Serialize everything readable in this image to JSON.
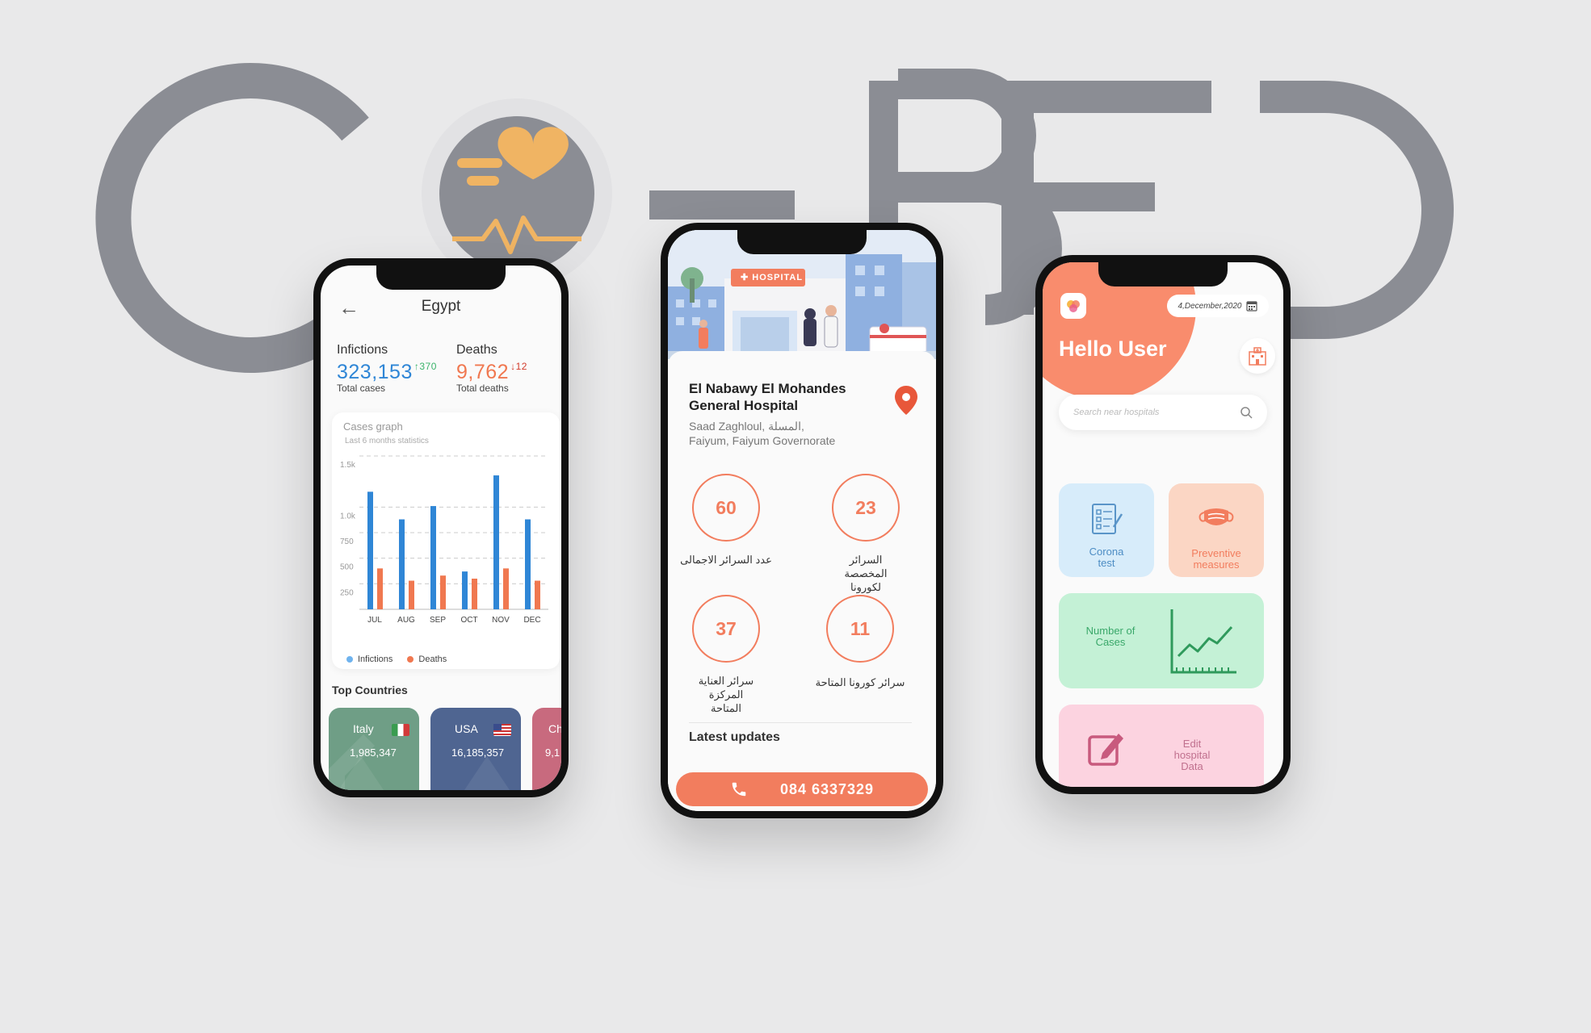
{
  "colors": {
    "accent": "#f27d5e",
    "infections": "#2f86d6",
    "deaths": "#f07850",
    "logo": "#8b8d94"
  },
  "stats_screen": {
    "title": "Egypt",
    "infections": {
      "label": "Infictions",
      "value": "323,153",
      "delta": "370",
      "sub": "Total cases"
    },
    "deaths": {
      "label": "Deaths",
      "value": "9,762",
      "delta": "12",
      "sub": "Total deaths"
    },
    "graph": {
      "title": "Cases graph",
      "subtitle": "Last 6 months statistics",
      "legend_infections": "Infictions",
      "legend_deaths": "Deaths"
    },
    "top_countries_label": "Top Countries",
    "countries": [
      {
        "name": "Italy",
        "value": "1,985,347"
      },
      {
        "name": "USA",
        "value": "16,185,357"
      },
      {
        "name": "Ch",
        "value": "9,1"
      }
    ]
  },
  "chart_data": {
    "type": "bar",
    "categories": [
      "JUL",
      "AUG",
      "SEP",
      "OCT",
      "NOV",
      "DEC"
    ],
    "y_ticks": [
      "1.5k",
      "1.0k",
      "750",
      "500",
      "250"
    ],
    "series": [
      {
        "name": "Infictions",
        "values": [
          1150,
          880,
          1010,
          370,
          1310,
          880
        ]
      },
      {
        "name": "Deaths",
        "values": [
          400,
          280,
          330,
          300,
          400,
          280
        ]
      }
    ],
    "ylim": [
      0,
      1500
    ],
    "grid": true,
    "legend": "bottom-left"
  },
  "hospital_screen": {
    "hero_sign": "HOSPITAL",
    "name": "El Nabawy El Mohandes General Hospital",
    "address_line1": "Saad Zaghloul, المسلة,",
    "address_line2": "Faiyum, Faiyum Governorate",
    "beds": [
      {
        "value": "60",
        "label": "عدد السرائر الاجمالى"
      },
      {
        "value": "23",
        "label": "السرائر المخصصة لكورونا"
      },
      {
        "value": "37",
        "label": "سرائر العناية المركزة المتاحة"
      },
      {
        "value": "11",
        "label": "سرائر كورونا المتاحة"
      }
    ],
    "latest_updates": "Latest updates",
    "phone": "084 6337329"
  },
  "home_screen": {
    "date": "4,December,2020",
    "greeting": "Hello User",
    "search_placeholder": "Search near hospitals",
    "tiles": {
      "corona_test": "Corona test",
      "preventive": "Preventive measures",
      "cases": "Number of Cases",
      "edit": "Edit hospital Data"
    }
  }
}
